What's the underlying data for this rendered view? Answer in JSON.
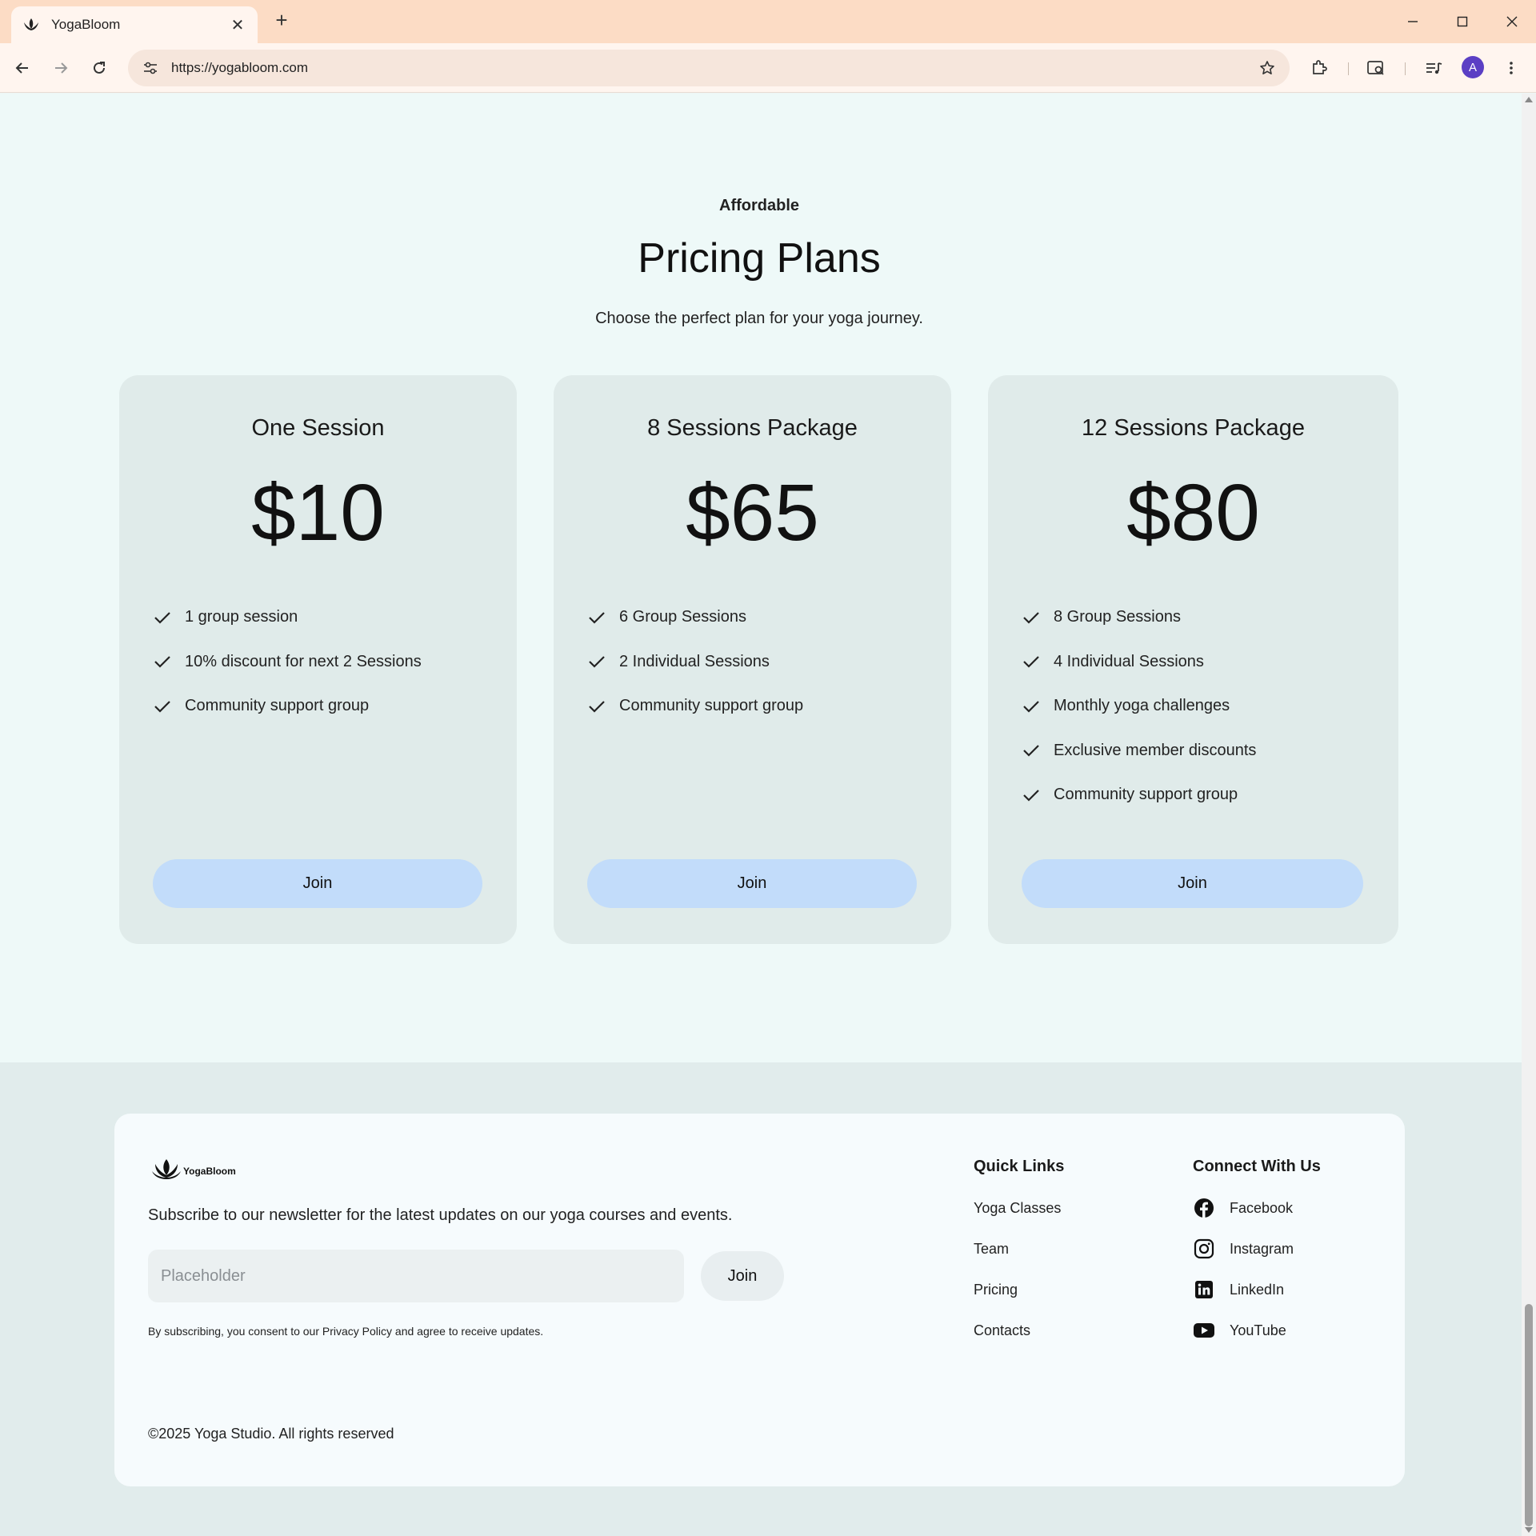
{
  "browser": {
    "tab_title": "YogaBloom",
    "tab_close": "✕",
    "new_tab": "+",
    "url": "https://yogabloom.com",
    "avatar_initial": "A"
  },
  "pricing": {
    "eyebrow": "Affordable",
    "title": "Pricing Plans",
    "subtitle": "Choose the perfect plan for your yoga journey.",
    "plans": [
      {
        "name": "One Session",
        "price": "$10",
        "features": [
          "1 group session",
          "10% discount for next 2 Sessions",
          "Community support group"
        ],
        "cta": "Join"
      },
      {
        "name": "8 Sessions Package",
        "price": "$65",
        "features": [
          "6 Group Sessions",
          "2 Individual Sessions",
          "Community support group"
        ],
        "cta": "Join"
      },
      {
        "name": "12 Sessions Package",
        "price": "$80",
        "features": [
          "8 Group Sessions",
          "4 Individual Sessions",
          "Monthly yoga challenges",
          "Exclusive member discounts",
          "Community support group"
        ],
        "cta": "Join"
      }
    ]
  },
  "footer": {
    "brand": "YogaBloom",
    "newsletter_text": "Subscribe to our newsletter for the latest updates on our yoga courses and events.",
    "email_placeholder": "Placeholder",
    "subscribe_label": "Join",
    "consent": "By subscribing, you consent to our Privacy Policy and agree to receive updates.",
    "copyright": "©2025 Yoga Studio. All rights reserved",
    "quick_links_heading": "Quick Links",
    "quick_links": [
      "Yoga Classes",
      "Team",
      "Pricing",
      "Contacts"
    ],
    "connect_heading": "Connect With Us",
    "social": [
      {
        "label": "Facebook",
        "icon": "facebook-icon"
      },
      {
        "label": "Instagram",
        "icon": "instagram-icon"
      },
      {
        "label": "LinkedIn",
        "icon": "linkedin-icon"
      },
      {
        "label": "YouTube",
        "icon": "youtube-icon"
      }
    ]
  },
  "colors": {
    "tab_bar": "#fcdcc5",
    "page_bg": "#eef9f8",
    "card_bg": "#e0ebea",
    "join_button": "#c2dcfa",
    "footer_band": "#e1ecec",
    "footer_card": "#f6fbfd",
    "avatar": "#5b3fc4"
  }
}
